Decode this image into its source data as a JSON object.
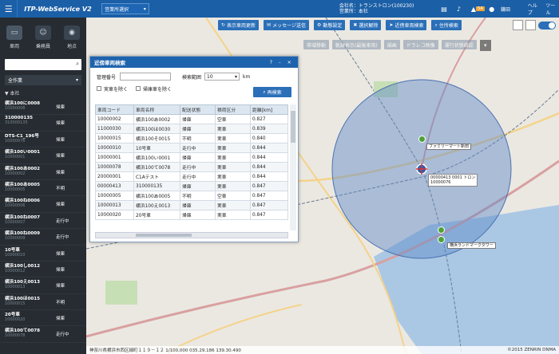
{
  "header": {
    "app_title": "ITP-WebService V2",
    "office_select": "営業所選択",
    "company_label": "会社名：トランストロン(100230)",
    "office_label": "営業所：本社",
    "notification_badge": "54",
    "user_name": "鎌田",
    "help_label": "ヘルプ",
    "tool_label": "ツール"
  },
  "sidebar": {
    "tabs": [
      {
        "label": "車両",
        "icon": "truck-icon"
      },
      {
        "label": "乗務員",
        "icon": "person-icon"
      },
      {
        "label": "地点",
        "icon": "pin-icon"
      }
    ],
    "filter_label": "全作業",
    "tree_root": "▼ 本社",
    "vehicles": [
      {
        "name": "横浜100に0008",
        "code": "10000008",
        "status": "帰庫"
      },
      {
        "name": "310000135",
        "code": "310000135",
        "status": "帰庫"
      },
      {
        "name": "DTS-C1_196号",
        "code": "10000076",
        "status": "帰庫"
      },
      {
        "name": "横浜100い0001",
        "code": "10000001",
        "status": "帰庫"
      },
      {
        "name": "横浜100あ0002",
        "code": "10000002",
        "status": "帰庫"
      },
      {
        "name": "横浜100あ0005",
        "code": "10000005",
        "status": "不明"
      },
      {
        "name": "横浜100ね0006",
        "code": "10000006",
        "status": "帰庫"
      },
      {
        "name": "横浜100ね0007",
        "code": "10000007",
        "status": "走行中"
      },
      {
        "name": "横浜100ね0009",
        "code": "10000009",
        "status": "走行中"
      },
      {
        "name": "10号車",
        "code": "10000010",
        "status": "帰庫"
      },
      {
        "name": "横浜100し0012",
        "code": "10000012",
        "status": "帰庫"
      },
      {
        "name": "横浜100え0013",
        "code": "10000013",
        "status": "帰庫"
      },
      {
        "name": "横浜100ほ0015",
        "code": "10000015",
        "status": "不明"
      },
      {
        "name": "20号車",
        "code": "10000020",
        "status": "帰庫"
      },
      {
        "name": "横浜100て0078",
        "code": "10000078",
        "status": "走行中"
      }
    ]
  },
  "toolbar": {
    "buttons": [
      {
        "label": "表示車両更新",
        "icon": "refresh-icon"
      },
      {
        "label": "メッセージ送信",
        "icon": "mail-icon"
      },
      {
        "label": "動態設定",
        "icon": "gear-icon"
      },
      {
        "label": "選択解除",
        "icon": "x-icon"
      },
      {
        "label": "近傍車両検索",
        "icon": "arrow-icon"
      },
      {
        "label": "住所検索",
        "icon": "search-icon"
      }
    ],
    "secondary": [
      "帯域移動",
      "軌跡表示(最後車両)",
      "描画",
      "ドラレコ映像",
      "運行状態確認"
    ]
  },
  "dialog": {
    "title": "近傍車両検索",
    "controls": "? - ×",
    "vehicle_no_label": "管理番号",
    "range_label": "検索範囲",
    "range_value": "10",
    "range_unit": "km",
    "exclude_empty_label": "実車を除く",
    "exclude_stopped_label": "帰庫車を除く",
    "search_button": "再検索",
    "columns": [
      "車両コード",
      "車両名称",
      "配送状態",
      "積荷区分",
      "距離[km]"
    ],
    "rows": [
      [
        "10000002",
        "横浜100あ0002",
        "帰庫",
        "空車",
        "0.827"
      ],
      [
        "11000030",
        "横浜100ほ0030",
        "帰庫",
        "実車",
        "0.839"
      ],
      [
        "10000015",
        "横浜100そ0015",
        "不明",
        "実車",
        "0.840"
      ],
      [
        "10000010",
        "10号車",
        "走行中",
        "実車",
        "0.844"
      ],
      [
        "10000001",
        "横浜100い0001",
        "帰庫",
        "実車",
        "0.844"
      ],
      [
        "10000078",
        "横浜100て0078",
        "走行中",
        "実車",
        "0.844"
      ],
      [
        "20000001",
        "C1Aテスト",
        "走行中",
        "実車",
        "0.844"
      ],
      [
        "00000413",
        "310000135",
        "帰庫",
        "実車",
        "0.847"
      ],
      [
        "10000005",
        "横浜100あ0005",
        "不明",
        "空車",
        "0.847"
      ],
      [
        "10000013",
        "横浜100え0013",
        "帰庫",
        "実車",
        "0.847"
      ],
      [
        "10000020",
        "20号車",
        "帰庫",
        "実車",
        "0.847"
      ]
    ]
  },
  "map": {
    "popup_lines": [
      "00000413 0001 トロン",
      "10000076"
    ],
    "poi_family": "ファミリーマート新田",
    "poi_tower": "横浜ランドマークタワー",
    "footer_address": "神奈川県横浜市西区緑町１１９－１２ 1/100,000 035.29.186 139.30.490",
    "copyright": "©2015 ZENRIN DNMA"
  }
}
